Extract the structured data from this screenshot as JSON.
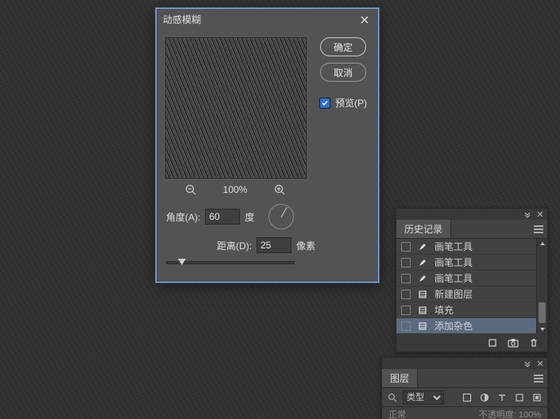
{
  "dialog": {
    "title": "动感模糊",
    "ok": "确定",
    "cancel": "取消",
    "preview_label": "预览(P)",
    "preview_checked": true,
    "zoom_pct": "100%",
    "angle_label": "角度(A):",
    "angle_unit": "度",
    "angle_value": "60",
    "distance_label": "距离(D):",
    "distance_unit": "像素",
    "distance_value": "25",
    "slider_pct": 12
  },
  "history": {
    "title": "历史记录",
    "items": [
      {
        "icon": "brush",
        "label": "画笔工具"
      },
      {
        "icon": "brush",
        "label": "画笔工具"
      },
      {
        "icon": "brush",
        "label": "画笔工具"
      },
      {
        "icon": "newlayer",
        "label": "新建图层"
      },
      {
        "icon": "fill",
        "label": "填充"
      },
      {
        "icon": "fill",
        "label": "添加杂色"
      }
    ],
    "selected_index": 5
  },
  "layers": {
    "title": "图层",
    "filter_placeholder": "类型",
    "blend_mode": "正常",
    "opacity_label": "不透明度",
    "opacity_value": "100%"
  }
}
